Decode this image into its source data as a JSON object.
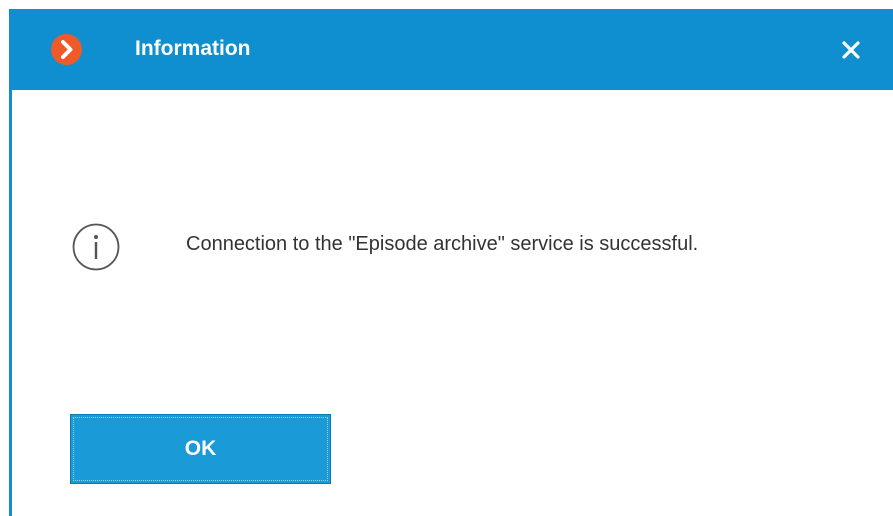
{
  "dialog": {
    "title": "Information",
    "message": "Connection to the \"Episode archive\" service is successful.",
    "ok_label": "OK",
    "icons": {
      "app": "app-logo-chevron-icon",
      "close": "close-icon",
      "info": "info-circle-icon"
    },
    "colors": {
      "titlebar": "#0f8fd0",
      "logo": "#ef5a29",
      "button": "#1a9ad6",
      "text": "#333333"
    }
  }
}
